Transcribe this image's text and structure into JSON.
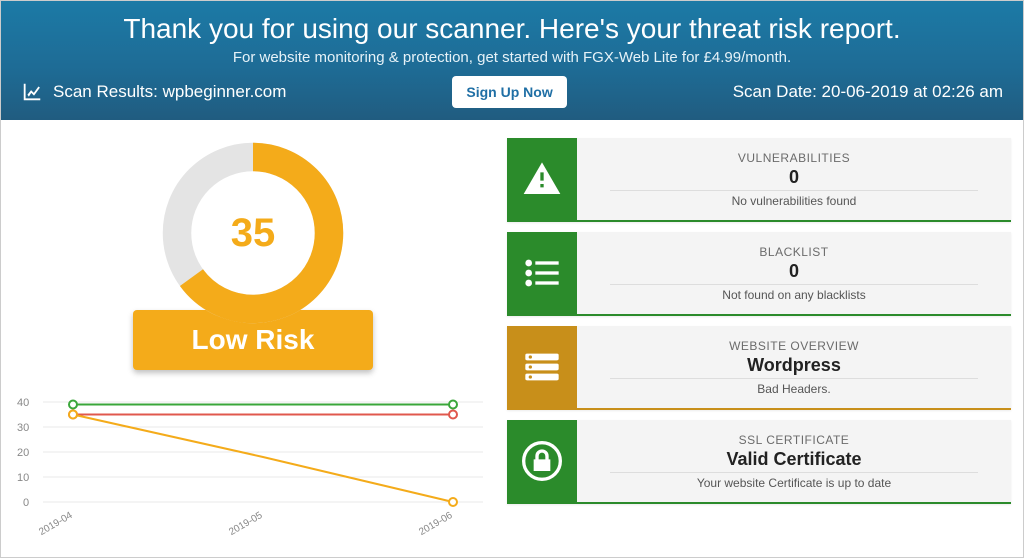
{
  "header": {
    "title": "Thank you for using our scanner. Here's your threat risk report.",
    "subtitle": "For website monitoring & protection, get started with FGX-Web Lite for £4.99/month.",
    "scan_results_label": "Scan Results: wpbeginner.com",
    "signup_label": "Sign Up Now",
    "scan_date_label": "Scan Date: 20-06-2019 at 02:26 am"
  },
  "risk": {
    "score": "35",
    "badge_label": "Low Risk"
  },
  "cards": {
    "vuln": {
      "title": "VULNERABILITIES",
      "value": "0",
      "note": "No vulnerabilities found",
      "color": "#2b8b2b"
    },
    "black": {
      "title": "BLACKLIST",
      "value": "0",
      "note": "Not found on any blacklists",
      "color": "#2b8b2b"
    },
    "over": {
      "title": "WEBSITE OVERVIEW",
      "value": "Wordpress",
      "note": "Bad Headers.",
      "color": "#c88f1a"
    },
    "ssl": {
      "title": "SSL CERTIFICATE",
      "value": "Valid Certificate",
      "note": "Your website Certificate is up to date",
      "color": "#2b8b2b"
    }
  },
  "chart_data": {
    "type": "line",
    "xlabel": "",
    "ylabel": "",
    "ylim": [
      0,
      40
    ],
    "y_ticks": [
      0,
      10,
      20,
      30,
      40
    ],
    "categories": [
      "2019-04",
      "2019-05",
      "2019-06"
    ],
    "series": [
      {
        "name": "green",
        "color": "#3aa63a",
        "values": [
          39,
          39,
          39
        ]
      },
      {
        "name": "red",
        "color": "#e0584d",
        "values": [
          35,
          35,
          35
        ]
      },
      {
        "name": "orange",
        "color": "#f4ab1a",
        "values": [
          35,
          18,
          0
        ]
      }
    ]
  },
  "gauge": {
    "percent": 65,
    "color_arc": "#f4ab1a",
    "color_track": "#e4e4e4"
  },
  "linechart_labels": {
    "y0": "0",
    "y1": "10",
    "y2": "20",
    "y3": "30",
    "y4": "40",
    "x0": "2019-04",
    "x1": "2019-05",
    "x2": "2019-06"
  }
}
